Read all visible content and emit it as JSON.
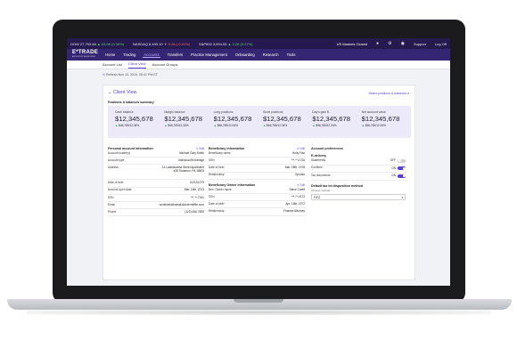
{
  "ticker": {
    "dow_label": "DOW 27,753.48",
    "dow_change": "▲ 63.08 (0.35%)",
    "nasdaq_label": "NASDAQ 8,493.10",
    "nasdaq_change": "▼ 0.26 (-0.01%)",
    "sp_label": "S&P500 3,094.03",
    "sp_change": "▲ 2.28 (0.07%)",
    "market_status": "US Markets Closed",
    "support": "Support",
    "logoff": "Log Off"
  },
  "nav": {
    "logo": "E*TRADE",
    "logo_sub": "ADVISOR SERVICES",
    "items": [
      "Home",
      "Trading",
      "Accounts",
      "Transfers",
      "Practice Management",
      "Onboarding",
      "Research",
      "Tools"
    ]
  },
  "subnav": {
    "tabs": [
      "Account List",
      "Client View",
      "Account Groups"
    ]
  },
  "refresh": {
    "label": "Refresh",
    "timestamp": "Nov 13, 2019, 08:41 PM ET"
  },
  "client_view": {
    "title": "Client View",
    "select_link": "Select positions & balances ▾",
    "summary_title": "Positions & balances summary",
    "metrics": [
      {
        "label": "Cash balance",
        "value": "$12,345,678",
        "change": "$46,765/12.34%"
      },
      {
        "label": "Margin balance",
        "value": "$12,345,678",
        "change": "$46,765/12.34%"
      },
      {
        "label": "Long positions",
        "value": "$12,345,678",
        "change": "$46,765/12.34%"
      },
      {
        "label": "Short positions",
        "value": "$12,345,678",
        "change": "$46,765/12.34%"
      },
      {
        "label": "Day's gain $",
        "value": "$12,345,678",
        "change": "$46,765/12.34%"
      },
      {
        "label": "Net account value",
        "value": "$12,345,678",
        "change": "$46,765/12.34%"
      }
    ]
  },
  "personal": {
    "title": "Personal account information",
    "edit": "Edit",
    "rows": [
      {
        "label": "Account holder(s)",
        "value": "Michael Gary Smith"
      },
      {
        "label": "Account type",
        "value": "Individual Brokerage"
      },
      {
        "label": "Address",
        "value": "14 Lackawanna Street Apartment #28 Scranton, PA 18503"
      },
      {
        "label": "Date of birth",
        "value": "01/02/1973"
      },
      {
        "label": "Account open date",
        "value": "Mar. 16th, 2013"
      },
      {
        "label": "SSN",
        "value": "***-**-7181"
      },
      {
        "label": "Email",
        "value": "worldsbestboss@dundermifflin.com"
      },
      {
        "label": "Phone",
        "value": "(123) 456-7890"
      }
    ]
  },
  "beneficiary": {
    "title": "Beneficiary information",
    "edit": "Edit",
    "rows": [
      {
        "label": "Beneficiary name",
        "value": "Holly Flax"
      },
      {
        "label": "SSN",
        "value": "***-**-1726"
      },
      {
        "label": "Date of birth",
        "value": "Mar. 28th, 1978"
      },
      {
        "label": "Relationship",
        "value": "Spouse"
      }
    ]
  },
  "beneficial_owner": {
    "title": "Beneficiary Owner Information",
    "edit": "Edit",
    "rows": [
      {
        "label": "Ben. Owner name",
        "value": "Steve Carell"
      },
      {
        "label": "SSN",
        "value": "***-**-4172"
      },
      {
        "label": "Date of birth",
        "value": "Apr. 16th, 1972"
      },
      {
        "label": "Relationship",
        "value": "Finance Attorney"
      }
    ]
  },
  "preferences": {
    "title": "Account preferences",
    "edelivery_title": "E-delivery",
    "rows": [
      {
        "label": "Statements",
        "state": "OFF",
        "on": false
      },
      {
        "label": "Confirms",
        "state": "ON",
        "on": true
      },
      {
        "label": "Tax documents",
        "state": "ON",
        "on": true
      }
    ],
    "tax_title": "Default tax lot disposition method",
    "tax_sub": "Choose method",
    "tax_value": "FIFO"
  }
}
